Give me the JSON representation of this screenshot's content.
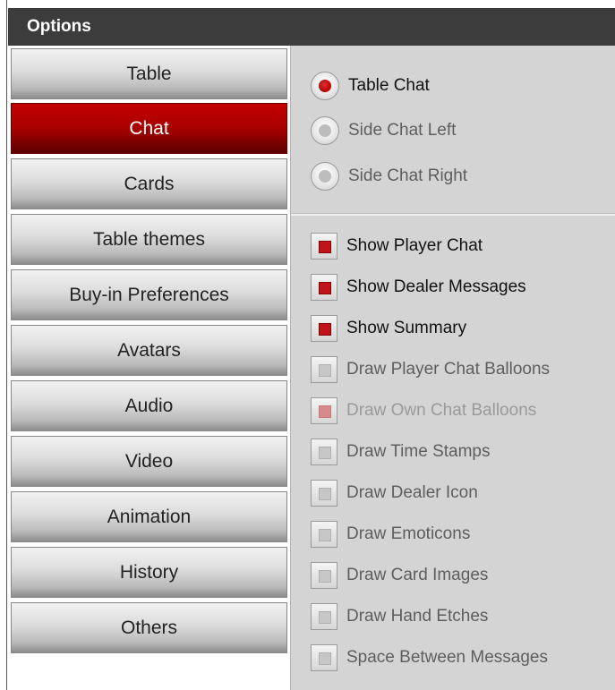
{
  "window": {
    "title": "Options"
  },
  "nav": {
    "items": [
      {
        "label": "Table",
        "active": false
      },
      {
        "label": "Chat",
        "active": true
      },
      {
        "label": "Cards",
        "active": false
      },
      {
        "label": "Table themes",
        "active": false
      },
      {
        "label": "Buy-in Preferences",
        "active": false
      },
      {
        "label": "Avatars",
        "active": false
      },
      {
        "label": "Audio",
        "active": false
      },
      {
        "label": "Video",
        "active": false
      },
      {
        "label": "Animation",
        "active": false
      },
      {
        "label": "History",
        "active": false
      },
      {
        "label": "Others",
        "active": false
      }
    ]
  },
  "chat_position": {
    "options": [
      {
        "label": "Table Chat",
        "selected": true,
        "enabled": true
      },
      {
        "label": "Side Chat Left",
        "selected": false,
        "enabled": false
      },
      {
        "label": "Side Chat Right",
        "selected": false,
        "enabled": false
      }
    ]
  },
  "chat_options": {
    "items": [
      {
        "label": "Show Player Chat",
        "checked": true,
        "enabled": true
      },
      {
        "label": "Show Dealer Messages",
        "checked": true,
        "enabled": true
      },
      {
        "label": "Show Summary",
        "checked": true,
        "enabled": true
      },
      {
        "label": "Draw Player Chat Balloons",
        "checked": false,
        "enabled": false
      },
      {
        "label": "Draw Own Chat Balloons",
        "checked": true,
        "enabled": false
      },
      {
        "label": "Draw Time Stamps",
        "checked": false,
        "enabled": false
      },
      {
        "label": "Draw Dealer Icon",
        "checked": false,
        "enabled": false
      },
      {
        "label": "Draw Emoticons",
        "checked": false,
        "enabled": false
      },
      {
        "label": "Draw Card Images",
        "checked": false,
        "enabled": false
      },
      {
        "label": "Draw Hand Etches",
        "checked": false,
        "enabled": false
      },
      {
        "label": "Space Between Messages",
        "checked": false,
        "enabled": false
      }
    ]
  },
  "colors": {
    "accent": "#b00000",
    "titlebar": "#3c3c3c",
    "panel": "#d4d4d4"
  }
}
